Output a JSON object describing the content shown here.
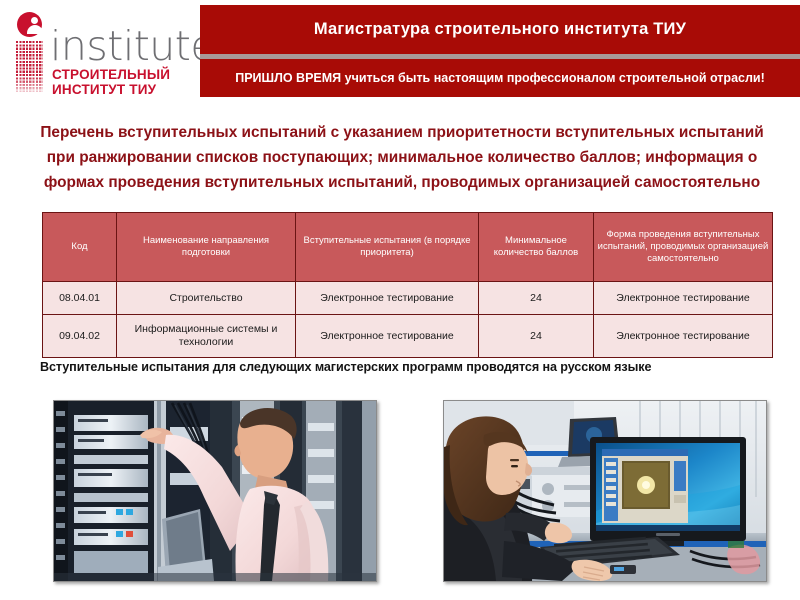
{
  "logo": {
    "word": "institute",
    "sub_line1": "СТРОИТЕЛЬНЫЙ",
    "sub_line2": "ИНСТИТУТ ТИУ",
    "mark_icon": "person-in-circle-icon",
    "accent_color": "#c8102e"
  },
  "banner": {
    "title": "Магистратура строительного института ТИУ",
    "subtitle": "ПРИШЛО ВРЕМЯ учиться быть настоящим профессионалом строительной отрасли!",
    "bg_color": "#a80b06",
    "divider_color": "#a89a98",
    "text_color": "#ffffff"
  },
  "intro": {
    "text": "Перечень вступительных испытаний с указанием приоритетности вступительных испытаний при ранжировании списков поступающих; минимальное количество баллов; информация о формах проведения вступительных испытаний, проводимых организацией самостоятельно",
    "color": "#8c1116"
  },
  "table": {
    "header_bg": "#c8595b",
    "body_bg": "#f6e3e3",
    "border_color": "#6b1414",
    "columns": [
      "Код",
      "Наименование направления подготовки",
      "Вступительные испытания (в порядке приоритета)",
      "Минимальное количество баллов",
      "Форма проведения вступительных испытаний, проводимых организацией самостоятельно"
    ],
    "rows": [
      {
        "code": "08.04.01",
        "program": "Строительство",
        "exam": "Электронное тестирование",
        "min_score": "24",
        "form": "Электронное тестирование"
      },
      {
        "code": "09.04.02",
        "program": "Информационные системы и технологии",
        "exam": "Электронное тестирование",
        "min_score": "24",
        "form": "Электронное тестирование"
      }
    ]
  },
  "caption": {
    "text": "Вступительные испытания для следующих магистерских программ проводятся на русском языке"
  },
  "photos": [
    {
      "name": "server-room-technician-photo",
      "alt": "Мужчина в розовой рубашке и галстуке работает со стойками серверов в серверной"
    },
    {
      "name": "laboratory-computer-workstation-photo",
      "alt": "Девушка за компьютером с широким монитором в лаборатории"
    }
  ]
}
